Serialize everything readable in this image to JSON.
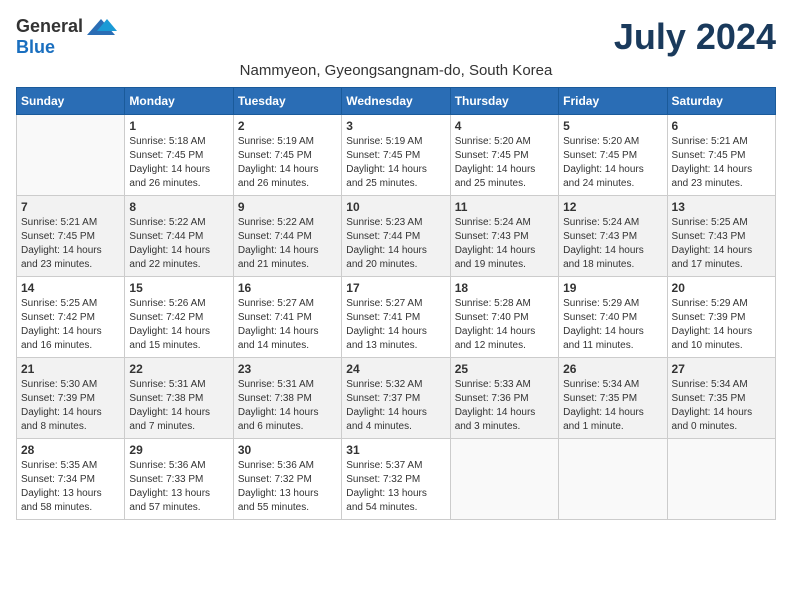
{
  "logo": {
    "general": "General",
    "blue": "Blue"
  },
  "title": "July 2024",
  "subtitle": "Nammyeon, Gyeongsangnam-do, South Korea",
  "days_header": [
    "Sunday",
    "Monday",
    "Tuesday",
    "Wednesday",
    "Thursday",
    "Friday",
    "Saturday"
  ],
  "weeks": [
    [
      {
        "day": "",
        "info": ""
      },
      {
        "day": "1",
        "info": "Sunrise: 5:18 AM\nSunset: 7:45 PM\nDaylight: 14 hours\nand 26 minutes."
      },
      {
        "day": "2",
        "info": "Sunrise: 5:19 AM\nSunset: 7:45 PM\nDaylight: 14 hours\nand 26 minutes."
      },
      {
        "day": "3",
        "info": "Sunrise: 5:19 AM\nSunset: 7:45 PM\nDaylight: 14 hours\nand 25 minutes."
      },
      {
        "day": "4",
        "info": "Sunrise: 5:20 AM\nSunset: 7:45 PM\nDaylight: 14 hours\nand 25 minutes."
      },
      {
        "day": "5",
        "info": "Sunrise: 5:20 AM\nSunset: 7:45 PM\nDaylight: 14 hours\nand 24 minutes."
      },
      {
        "day": "6",
        "info": "Sunrise: 5:21 AM\nSunset: 7:45 PM\nDaylight: 14 hours\nand 23 minutes."
      }
    ],
    [
      {
        "day": "7",
        "info": "Sunrise: 5:21 AM\nSunset: 7:45 PM\nDaylight: 14 hours\nand 23 minutes."
      },
      {
        "day": "8",
        "info": "Sunrise: 5:22 AM\nSunset: 7:44 PM\nDaylight: 14 hours\nand 22 minutes."
      },
      {
        "day": "9",
        "info": "Sunrise: 5:22 AM\nSunset: 7:44 PM\nDaylight: 14 hours\nand 21 minutes."
      },
      {
        "day": "10",
        "info": "Sunrise: 5:23 AM\nSunset: 7:44 PM\nDaylight: 14 hours\nand 20 minutes."
      },
      {
        "day": "11",
        "info": "Sunrise: 5:24 AM\nSunset: 7:43 PM\nDaylight: 14 hours\nand 19 minutes."
      },
      {
        "day": "12",
        "info": "Sunrise: 5:24 AM\nSunset: 7:43 PM\nDaylight: 14 hours\nand 18 minutes."
      },
      {
        "day": "13",
        "info": "Sunrise: 5:25 AM\nSunset: 7:43 PM\nDaylight: 14 hours\nand 17 minutes."
      }
    ],
    [
      {
        "day": "14",
        "info": "Sunrise: 5:25 AM\nSunset: 7:42 PM\nDaylight: 14 hours\nand 16 minutes."
      },
      {
        "day": "15",
        "info": "Sunrise: 5:26 AM\nSunset: 7:42 PM\nDaylight: 14 hours\nand 15 minutes."
      },
      {
        "day": "16",
        "info": "Sunrise: 5:27 AM\nSunset: 7:41 PM\nDaylight: 14 hours\nand 14 minutes."
      },
      {
        "day": "17",
        "info": "Sunrise: 5:27 AM\nSunset: 7:41 PM\nDaylight: 14 hours\nand 13 minutes."
      },
      {
        "day": "18",
        "info": "Sunrise: 5:28 AM\nSunset: 7:40 PM\nDaylight: 14 hours\nand 12 minutes."
      },
      {
        "day": "19",
        "info": "Sunrise: 5:29 AM\nSunset: 7:40 PM\nDaylight: 14 hours\nand 11 minutes."
      },
      {
        "day": "20",
        "info": "Sunrise: 5:29 AM\nSunset: 7:39 PM\nDaylight: 14 hours\nand 10 minutes."
      }
    ],
    [
      {
        "day": "21",
        "info": "Sunrise: 5:30 AM\nSunset: 7:39 PM\nDaylight: 14 hours\nand 8 minutes."
      },
      {
        "day": "22",
        "info": "Sunrise: 5:31 AM\nSunset: 7:38 PM\nDaylight: 14 hours\nand 7 minutes."
      },
      {
        "day": "23",
        "info": "Sunrise: 5:31 AM\nSunset: 7:38 PM\nDaylight: 14 hours\nand 6 minutes."
      },
      {
        "day": "24",
        "info": "Sunrise: 5:32 AM\nSunset: 7:37 PM\nDaylight: 14 hours\nand 4 minutes."
      },
      {
        "day": "25",
        "info": "Sunrise: 5:33 AM\nSunset: 7:36 PM\nDaylight: 14 hours\nand 3 minutes."
      },
      {
        "day": "26",
        "info": "Sunrise: 5:34 AM\nSunset: 7:35 PM\nDaylight: 14 hours\nand 1 minute."
      },
      {
        "day": "27",
        "info": "Sunrise: 5:34 AM\nSunset: 7:35 PM\nDaylight: 14 hours\nand 0 minutes."
      }
    ],
    [
      {
        "day": "28",
        "info": "Sunrise: 5:35 AM\nSunset: 7:34 PM\nDaylight: 13 hours\nand 58 minutes."
      },
      {
        "day": "29",
        "info": "Sunrise: 5:36 AM\nSunset: 7:33 PM\nDaylight: 13 hours\nand 57 minutes."
      },
      {
        "day": "30",
        "info": "Sunrise: 5:36 AM\nSunset: 7:32 PM\nDaylight: 13 hours\nand 55 minutes."
      },
      {
        "day": "31",
        "info": "Sunrise: 5:37 AM\nSunset: 7:32 PM\nDaylight: 13 hours\nand 54 minutes."
      },
      {
        "day": "",
        "info": ""
      },
      {
        "day": "",
        "info": ""
      },
      {
        "day": "",
        "info": ""
      }
    ]
  ]
}
